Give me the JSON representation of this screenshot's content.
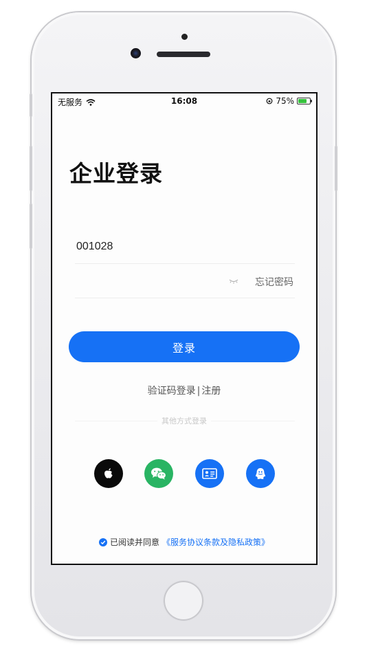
{
  "status_bar": {
    "carrier": "无服务",
    "time": "16:08",
    "battery_percent": "75%",
    "battery_level": 0.75,
    "battery_color": "#36c33d"
  },
  "login": {
    "title": "企业登录",
    "account_value": "001028",
    "password_value": "",
    "forgot_password": "忘记密码",
    "login_button": "登录",
    "code_login": "验证码登录",
    "separator": "|",
    "register": "注册",
    "other_methods": "其他方式登录",
    "social": [
      {
        "name": "apple-icon",
        "color": "#0a0a0a"
      },
      {
        "name": "wechat-icon",
        "color": "#29b463"
      },
      {
        "name": "id-card-icon",
        "color": "#1671f5"
      },
      {
        "name": "qq-icon",
        "color": "#1671f5"
      }
    ],
    "agreement_prefix": "已阅读并同意",
    "agreement_link": "《服务协议条款及隐私政策》",
    "agreement_checked": true
  },
  "colors": {
    "accent": "#1671f5",
    "wechat": "#29b463"
  }
}
